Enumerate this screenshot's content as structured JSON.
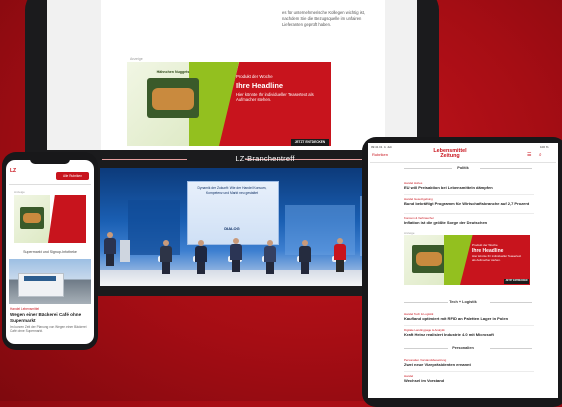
{
  "tablet_back": {
    "article_text": "es für unternehmerische Kollegen wichtig ist, nachdem Sie die Bezugsquelle im unfairen Lieferanten geprüft haben.",
    "ad_label": "Anzeige"
  },
  "ad": {
    "kicker": "Produkt der Woche",
    "headline": "Ihre Headline",
    "body": "Hier könnte Ihr individueller Teasertext als Aufmacher stehen.",
    "cta": "JETZT ENTDECKEN",
    "product_label": "Hähnchen Nuggets"
  },
  "stage": {
    "title": "LZ-Branchentreff",
    "screen_text": "Dynamik der Zukunft: Wie der Handel Konsum, Kompetenz und Markt neu gestaltet",
    "screen_logo": "DIALOG"
  },
  "phone": {
    "logo": "LZ",
    "menu_button": "Alle Rubriken",
    "ad_label": "Anzeige",
    "section": "Supermarkt und Signup-Infotheke",
    "kicker": "Handel Lebensmittel",
    "headline": "Wegen einer Bäckerei Café ohne Supermarkt",
    "teaser": "Im kurzen Zeit der Planung von Wegen einer Bäckerei Café ohne Supermarkt."
  },
  "tablet2": {
    "status": "09:41 Di. 4. Juli",
    "battery": "100 %",
    "menu": "Rubriken",
    "logo_line1": "Lebensmittel",
    "logo_line2": "Zeitung",
    "icons": "☰ ⌕",
    "section_politik": "Politik",
    "articles": [
      {
        "kicker": "Handel Hohes",
        "title": "EU will Preisaktion bei Lebensmitteln dämpfen"
      },
      {
        "kicker": "Handel Gesetzgebung",
        "title": "Bund bekräftigt Programm für Wirtschaftsbranche auf 2,7 Prozent"
      },
      {
        "kicker": "Konsum & Verbraucher",
        "title": "Inflation ist die größte Sorge der Deutschen"
      }
    ],
    "ad_label": "Anzeige",
    "section_tech": "Tech + Logistik",
    "tech_articles": [
      {
        "kicker": "Handel Tech & Logistik",
        "title": "Kaufland optimiert mit RFID an Paletten Lager in Polen"
      },
      {
        "kicker": "Digitale Landingpage & Analytik",
        "title": "Kraft Heinz realisiert Industrie 4.0 mit Microsoft"
      }
    ],
    "section_personalien": "Personalien",
    "personal_articles": [
      {
        "kicker": "Personalien Vorstandsbesetzung",
        "title": "Zwei neue Vizepräsidenten ernannt"
      },
      {
        "kicker": "Handel",
        "title": "Wechsel im Vorstand"
      }
    ]
  }
}
